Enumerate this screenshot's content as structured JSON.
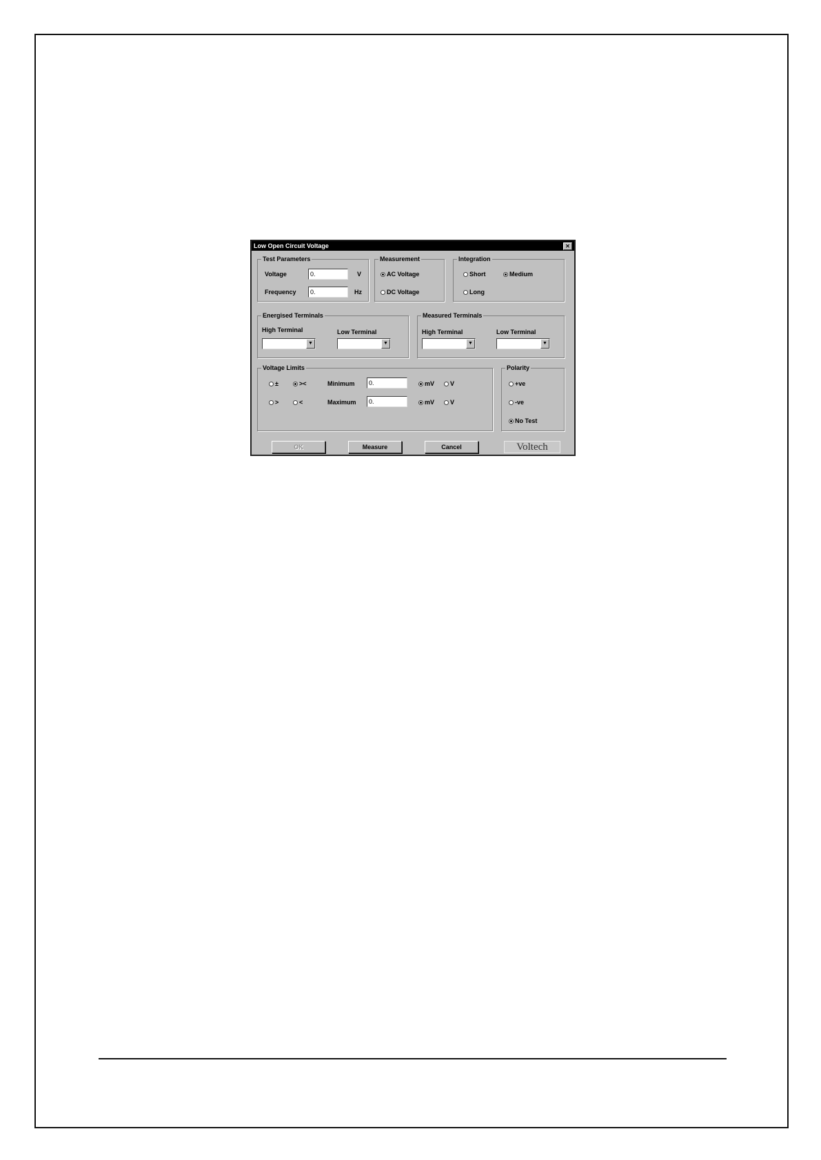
{
  "dialog": {
    "title": "Low Open Circuit Voltage",
    "close_glyph": "✕",
    "test_parameters": {
      "label": "Test Parameters",
      "voltage_label": "Voltage",
      "voltage_value": "0.",
      "voltage_unit": "V",
      "frequency_label": "Frequency",
      "frequency_value": "0.",
      "frequency_unit": "Hz"
    },
    "measurement": {
      "label": "Measurement",
      "options": [
        "AC Voltage",
        "DC Voltage"
      ],
      "selected": "AC Voltage"
    },
    "integration": {
      "label": "Integration",
      "options": [
        "Short",
        "Medium",
        "Long"
      ],
      "selected": "Medium"
    },
    "energised_terminals": {
      "label": "Energised Terminals",
      "high_label": "High Terminal",
      "low_label": "Low Terminal"
    },
    "measured_terminals": {
      "label": "Measured Terminals",
      "high_label": "High Terminal",
      "low_label": "Low Terminal"
    },
    "combo_arrow": "▼",
    "voltage_limits": {
      "label": "Voltage Limits",
      "compare_options": [
        "±",
        "><",
        ">",
        "<"
      ],
      "compare_selected": "><",
      "minimum_label": "Minimum",
      "minimum_value": "0.",
      "maximum_label": "Maximum",
      "maximum_value": "0.",
      "unit_options": [
        "mV",
        "V"
      ],
      "minimum_unit_selected": "mV",
      "maximum_unit_selected": "mV"
    },
    "polarity": {
      "label": "Polarity",
      "options": [
        "+ve",
        "-ve",
        "No Test"
      ],
      "selected": "No Test"
    },
    "buttons": {
      "ok": "OK",
      "measure": "Measure",
      "cancel": "Cancel"
    },
    "logo_text": "Voltech"
  }
}
